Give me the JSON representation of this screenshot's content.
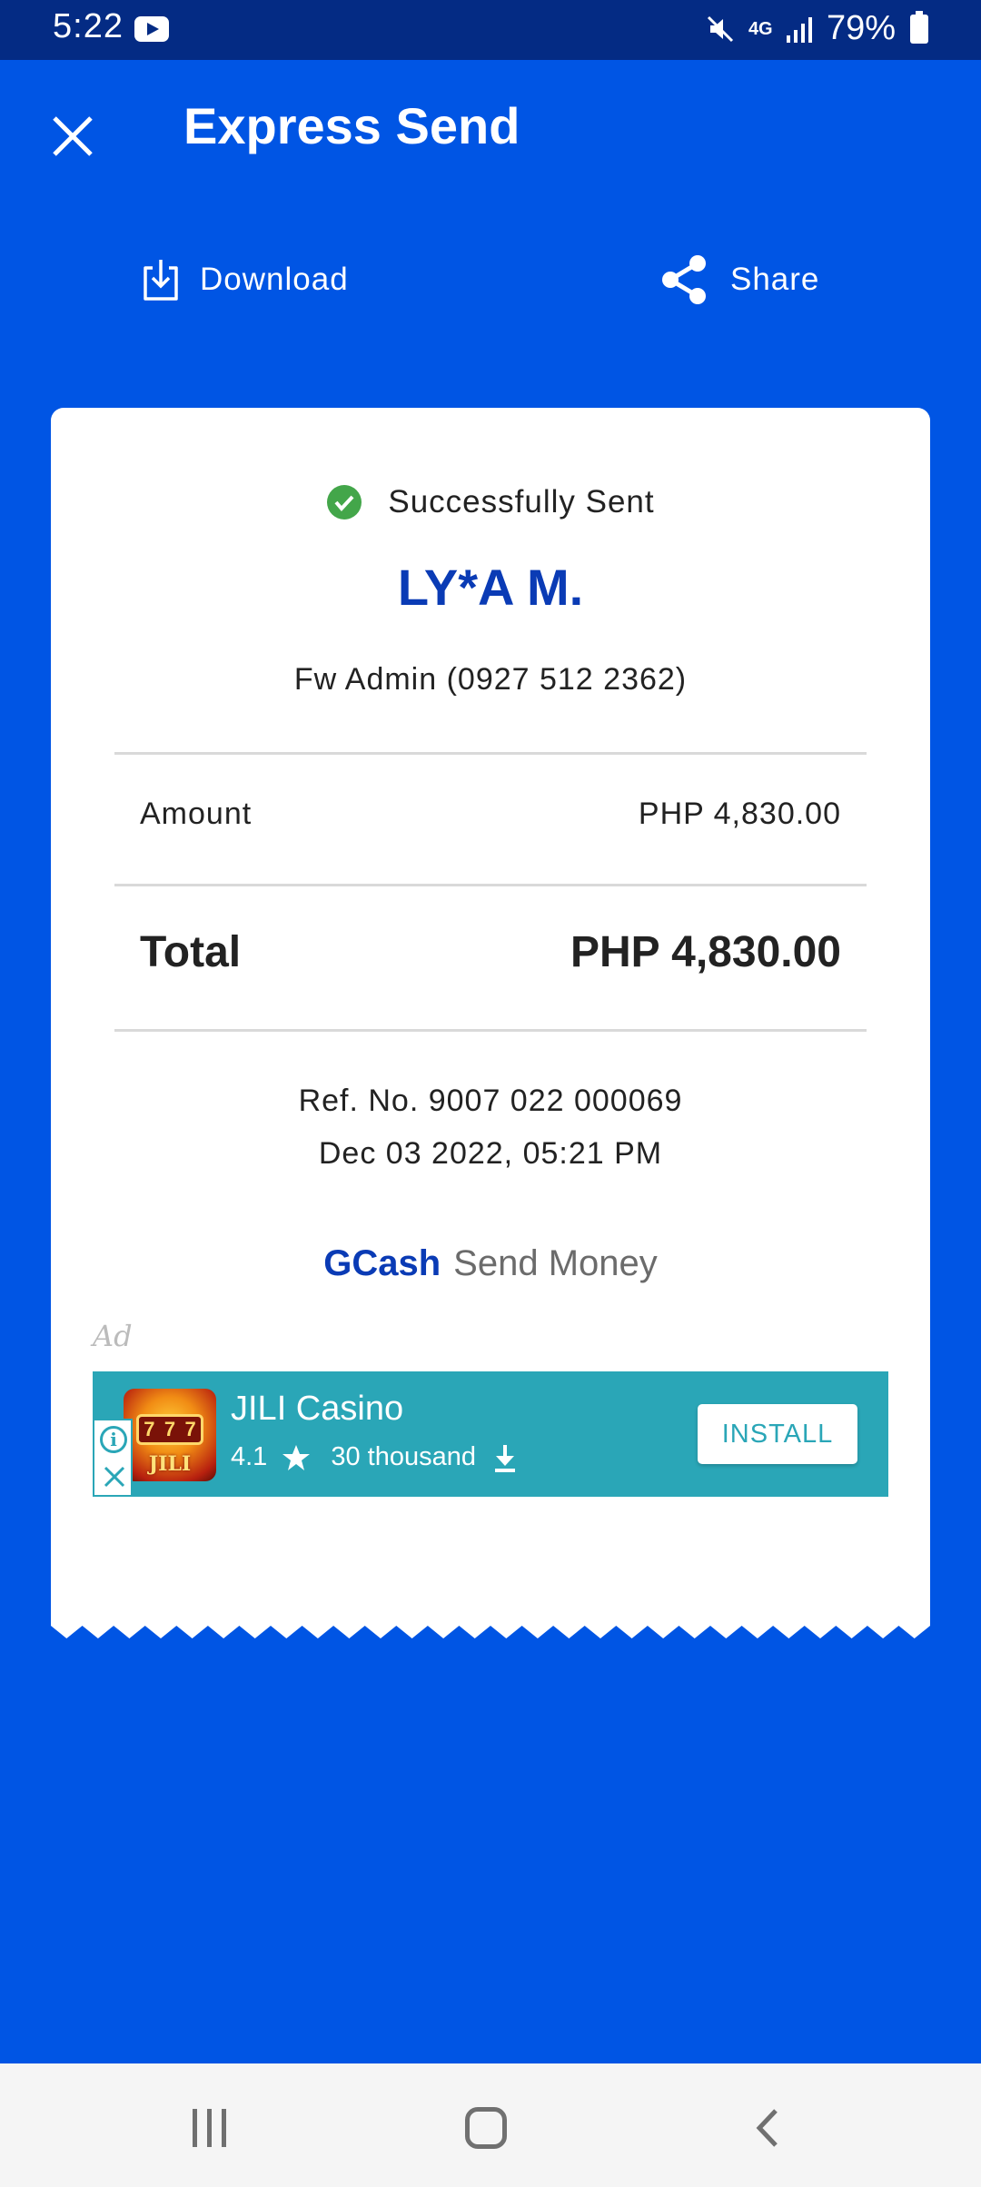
{
  "status_bar": {
    "time": "5:22",
    "network": "4G",
    "battery": "79%"
  },
  "header": {
    "title": "Express Send"
  },
  "actions": {
    "download_label": "Download",
    "share_label": "Share"
  },
  "receipt": {
    "status": "Successfully Sent",
    "recipient": "LY*A M.",
    "sender": "Fw Admin (0927 512 2362)",
    "amount_label": "Amount",
    "amount_value": "PHP 4,830.00",
    "total_label": "Total",
    "total_value": "PHP 4,830.00",
    "ref_no": "Ref. No. 9007 022 000069",
    "date": "Dec 03 2022, 05:21 PM",
    "brand_name": "GCash",
    "brand_service": "Send Money"
  },
  "ad": {
    "label": "Ad",
    "app_name": "JILI Casino",
    "rating": "4.1",
    "downloads": "30 thousand",
    "install_label": "INSTALL",
    "icon_text": "JILI",
    "icon_slots": [
      "7",
      "7",
      "7"
    ]
  },
  "colors": {
    "background": "#0055e4",
    "status_bar": "#042b84",
    "brand_blue": "#0a3bb5",
    "success_green": "#43a64a",
    "ad_teal": "#2aa6b7"
  },
  "icons": {
    "close": "close-icon",
    "download": "download-icon",
    "share": "share-icon",
    "success": "check-circle-icon"
  }
}
